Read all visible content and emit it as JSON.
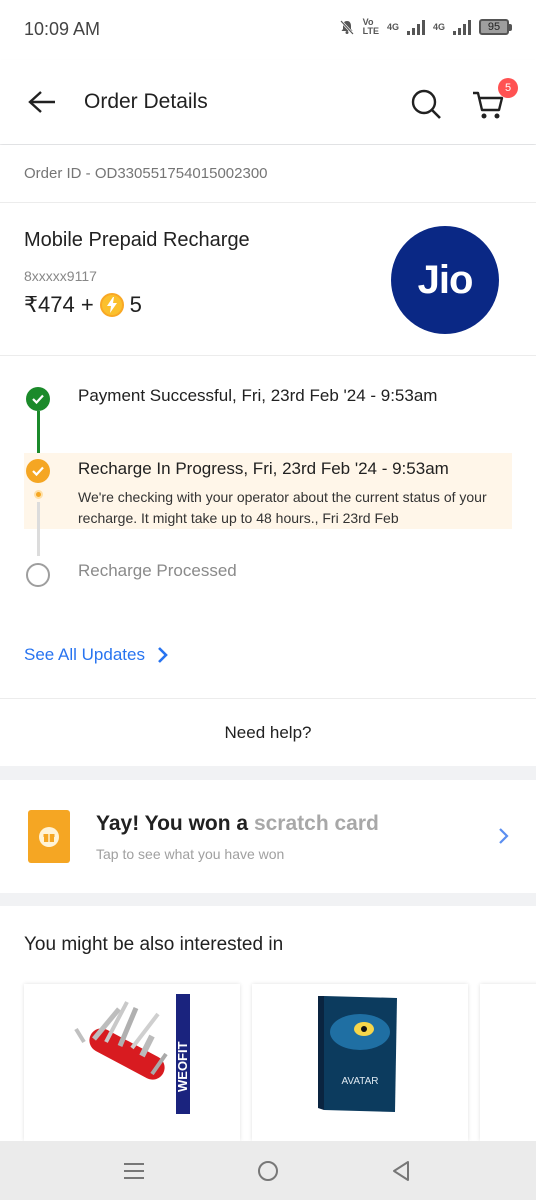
{
  "status_bar": {
    "time": "10:09 AM",
    "battery": "95",
    "net1": "Vo\nLTE",
    "net2": "4G",
    "net3": "4G"
  },
  "header": {
    "title": "Order Details",
    "cart_count": "5"
  },
  "order": {
    "order_id": "Order ID - OD330551754015002300",
    "product": "Mobile Prepaid Recharge",
    "masked_number": "8xxxxx9117",
    "price": "₹474 +",
    "coins": "5",
    "operator_logo_text": "Jio"
  },
  "timeline": {
    "steps": [
      {
        "title": "Payment Successful, Fri, 23rd Feb '24 - 9:53am",
        "state": "done"
      },
      {
        "title": "Recharge In Progress, Fri, 23rd Feb '24 - 9:53am",
        "state": "current",
        "description": "We're checking with your operator about the current status of your recharge. It might take up to 48 hours., Fri 23rd Feb"
      },
      {
        "title": "Recharge Processed",
        "state": "pending"
      }
    ]
  },
  "links": {
    "see_all": "See All Updates",
    "need_help": "Need help?"
  },
  "scratch": {
    "title_strong": "Yay! You won a",
    "title_fade": "scratch card",
    "subtitle": "Tap to see what you have won"
  },
  "recommendations": {
    "title": "You might be also interested in",
    "items": [
      {
        "name": "weofit-multitool",
        "brand_text": "WEOFIT"
      },
      {
        "name": "avatar-dvd",
        "brand_text": "AVATAR"
      }
    ]
  },
  "colors": {
    "success": "#1b8a2a",
    "progress": "#f5a623",
    "link": "#2874f0",
    "jio_blue": "#0a2885"
  }
}
